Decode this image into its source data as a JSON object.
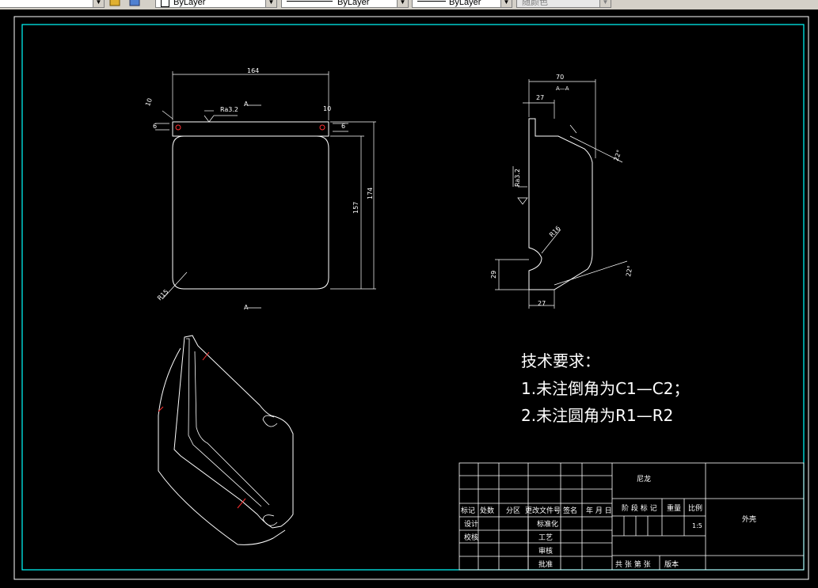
{
  "toolbar": {
    "layer_color_label": "ByLayer",
    "linetype_label": "ByLayer",
    "lineweight_label": "ByLayer",
    "plotstyle_label": "随颜色"
  },
  "drawing": {
    "front_view": {
      "dim_width": "164",
      "dim_hole_offset": "10",
      "dim_hole_offset_right": "10",
      "dim_small_a": "6",
      "dim_small_b": "6",
      "dim_height_inner": "157",
      "dim_height_outer": "174",
      "radius_corner": "R15",
      "roughness": "Ra3.2",
      "section_mark_top": "A",
      "section_mark_bottom": "A"
    },
    "section_view": {
      "title": "A—A",
      "dim_width": "70",
      "dim_top_lip": "27",
      "dim_bottom": "27",
      "dim_notch": "29",
      "radius_notch": "R16",
      "angle_top": "22°",
      "angle_bottom": "22°",
      "roughness": "Ra3.2"
    },
    "tech_requirements": {
      "heading": "技术要求：",
      "line1": "1.未注倒角为C1—C2；",
      "line2": "2.未注圆角为R1—R2"
    },
    "title_block": {
      "material": "尼龙",
      "part_name": "外壳",
      "scale": "1:5",
      "col_mark": "标记",
      "col_count": "处数",
      "col_zone": "分区",
      "col_change_doc": "更改文件号",
      "col_signature": "签名",
      "col_date": "年 月 日",
      "row_design": "设计",
      "row_check": "校核",
      "row_standard": "标准化",
      "row_process": "工艺",
      "row_review": "审核",
      "row_approve": "批准",
      "stage_mark": "阶 段 标 记",
      "weight": "重量",
      "ratio": "比例",
      "sheets": "共  张 第  张",
      "version": "版本"
    }
  }
}
